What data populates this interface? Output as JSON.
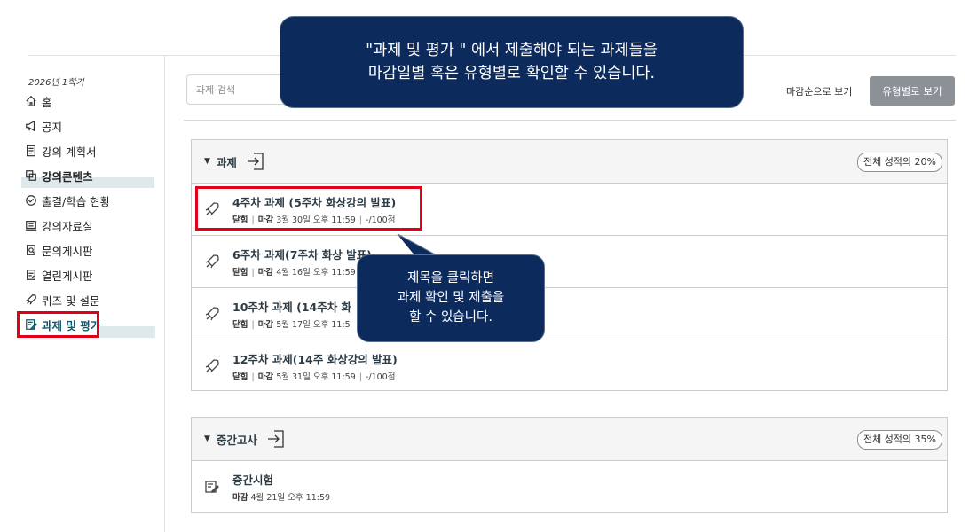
{
  "sidebar": {
    "term": "2026년 1학기",
    "items": [
      {
        "label": "홈",
        "icon": "home-icon"
      },
      {
        "label": "공지",
        "icon": "megaphone-icon"
      },
      {
        "label": "강의 계획서",
        "icon": "syllabus-icon"
      },
      {
        "label": "강의콘텐츠",
        "icon": "content-icon"
      },
      {
        "label": "출결/학습 현황",
        "icon": "attendance-icon"
      },
      {
        "label": "강의자료실",
        "icon": "archive-icon"
      },
      {
        "label": "문의게시판",
        "icon": "inquiry-board-icon"
      },
      {
        "label": "열린게시판",
        "icon": "open-board-icon"
      },
      {
        "label": "퀴즈 및 설문",
        "icon": "rocket-icon"
      },
      {
        "label": "과제 및 평가",
        "icon": "assignment-icon"
      }
    ]
  },
  "toolbar": {
    "search_placeholder": "과제 검색",
    "sort_by_due": "마감순으로 보기",
    "sort_by_type": "유형별로 보기"
  },
  "groups": [
    {
      "title": "과제",
      "weight": "전체 성적의 20%",
      "items": [
        {
          "title": "4주차 과제 (5주차 화상강의 발표)",
          "status": "닫힘",
          "due_label": "마감",
          "due": "3월 30일 오후 11:59",
          "points": "-/100점"
        },
        {
          "title": "6주차 과제(7주차 화상 발표)",
          "status": "닫힘",
          "due_label": "마감",
          "due": "4월 16일 오후 11:59",
          "points": ""
        },
        {
          "title": "10주차 과제 (14주차 화",
          "status": "닫힘",
          "due_label": "마감",
          "due": "5월 17일 오후 11:5",
          "points": ""
        },
        {
          "title": "12주차 과제(14주 화상강의 발표)",
          "status": "닫힘",
          "due_label": "마감",
          "due": "5월 31일 오후 11:59",
          "points": "-/100점"
        }
      ]
    },
    {
      "title": "중간고사",
      "weight": "전체 성적의 35%",
      "items": [
        {
          "title": "중간시험",
          "due_label": "마감",
          "due": "4월 21일 오후 11:59"
        }
      ]
    }
  ],
  "callouts": {
    "top_line1": "\"과제 및 평가 \" 에서 제출해야 되는 과제들을",
    "top_line2": "마감일별 혹은 유형별로 확인할 수 있습니다.",
    "mid_line1": "제목을 클릭하면",
    "mid_line2": "과제 확인 및 제출을",
    "mid_line3": "할 수 있습니다."
  },
  "colors": {
    "callout_bg": "#0d2a5c",
    "highlight_red": "#e0001a",
    "active_nav": "#0c5a6e",
    "button_gray": "#8b9197"
  }
}
